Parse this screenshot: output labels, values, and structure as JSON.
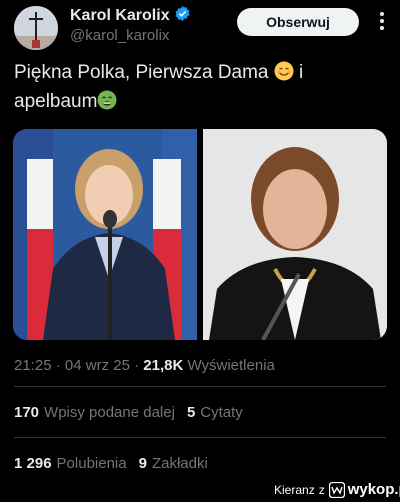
{
  "author": {
    "display_name": "Karol Karolix",
    "handle": "@karol_karolix",
    "verified": true,
    "badge_color": "#1d9bf0"
  },
  "follow_button": {
    "label": "Obserwuj"
  },
  "more_icon": "more-vertical-icon",
  "tweet": {
    "text_part1": "Piękna Polka, Pierwsza Dama ",
    "text_part2": " i apelbaum",
    "emoji_1": "smiling-face-icon",
    "emoji_2": "nauseated-face-icon"
  },
  "media": {
    "left_image": "woman-at-microphone-with-polish-flags",
    "right_image": "woman-speaking-at-microphone"
  },
  "meta": {
    "time": "21:25",
    "date": "04 wrz 25",
    "views_count": "21,8K",
    "views_label": "Wyświetlenia"
  },
  "stats": {
    "reposts_count": "170",
    "reposts_label": "Wpisy podane dalej",
    "quotes_count": "5",
    "quotes_label": "Cytaty",
    "likes_count": "1 296",
    "likes_label": "Polubienia",
    "bookmarks_count": "9",
    "bookmarks_label": "Zakładki"
  },
  "watermark": {
    "user": "Kieranz",
    "z": "z",
    "site": "wykop.pl"
  }
}
